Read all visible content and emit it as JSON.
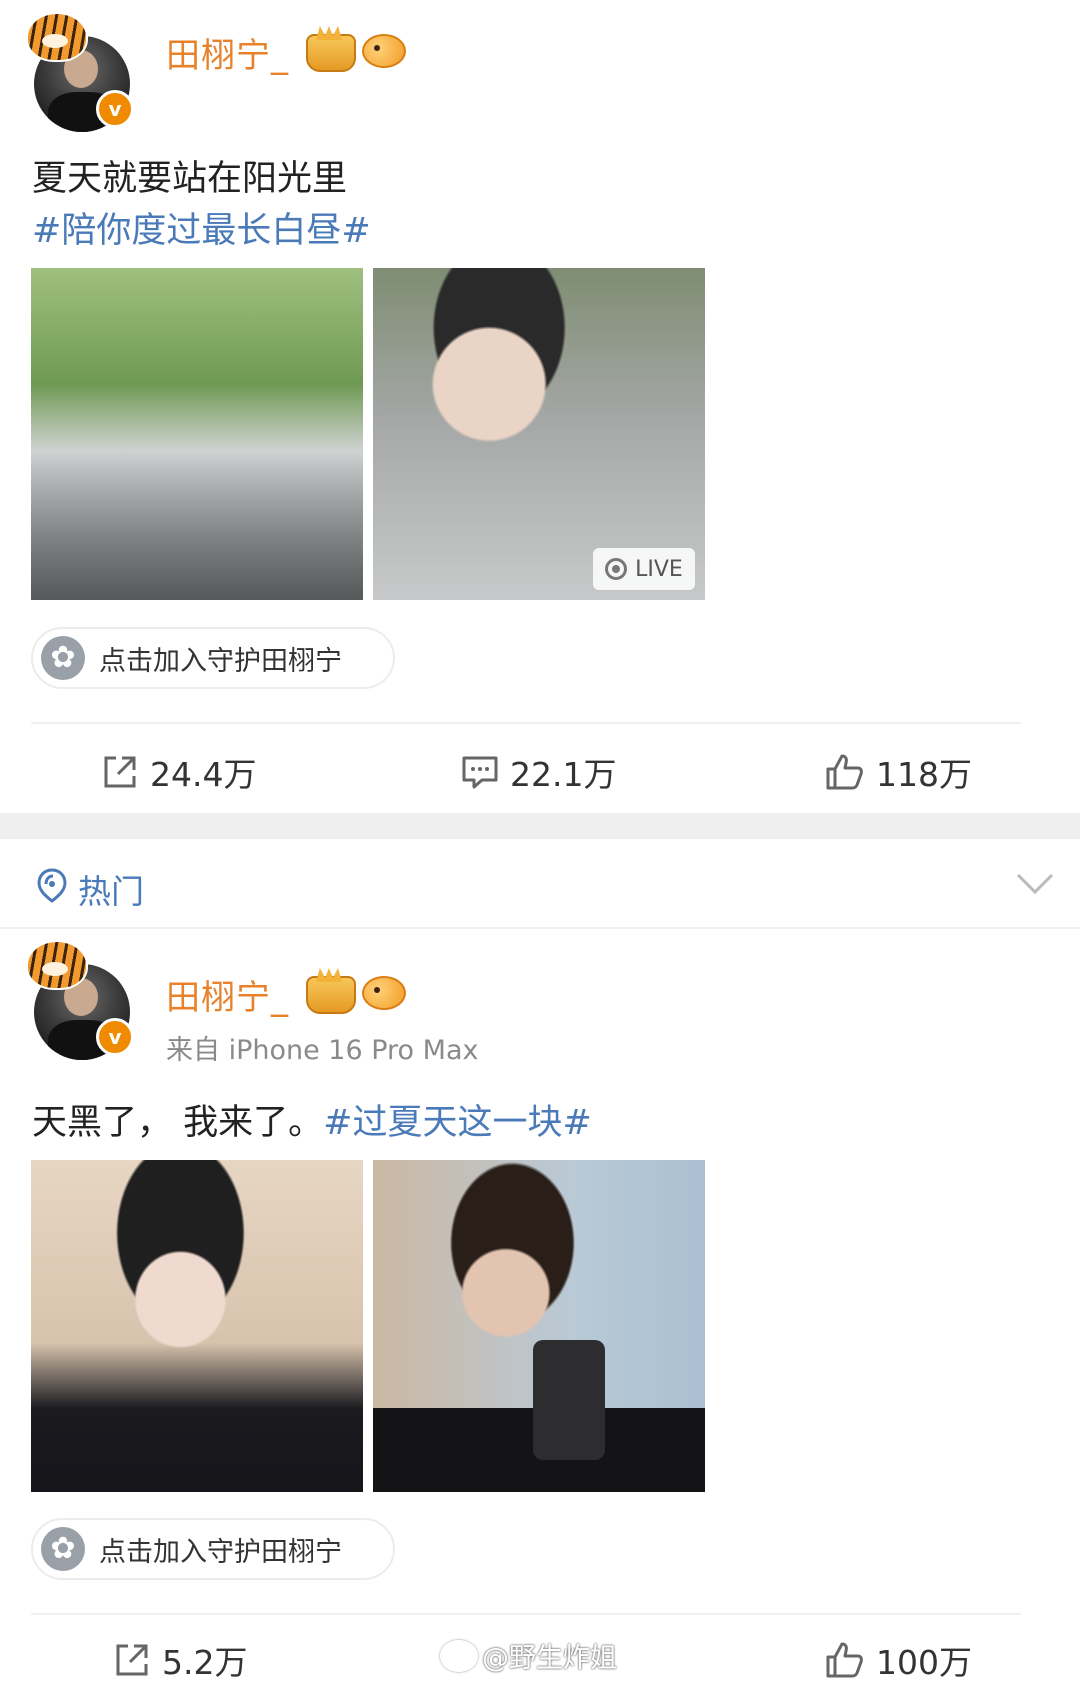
{
  "posts": [
    {
      "username": "田栩宁_",
      "text_line1": "夏天就要站在阳光里",
      "text_line2": "#陪你度过最长白昼#",
      "live_label": "LIVE",
      "guard_label": "点击加入守护田栩宁",
      "share_count": "24.4万",
      "comment_count": "22.1万",
      "like_count": "118万"
    },
    {
      "username": "田栩宁_",
      "source": "来自 iPhone 16 Pro Max",
      "text_plain": "天黑了， 我来了。",
      "text_hashtag": "#过夏天这一块#",
      "guard_label": "点击加入守护田栩宁",
      "share_count": "5.2万",
      "like_count": "100万"
    }
  ],
  "section": {
    "hot_label": "热门"
  },
  "watermark": "@野生炸姐",
  "colors": {
    "brand_orange": "#e8822a",
    "link_blue": "#4a7ab8"
  }
}
